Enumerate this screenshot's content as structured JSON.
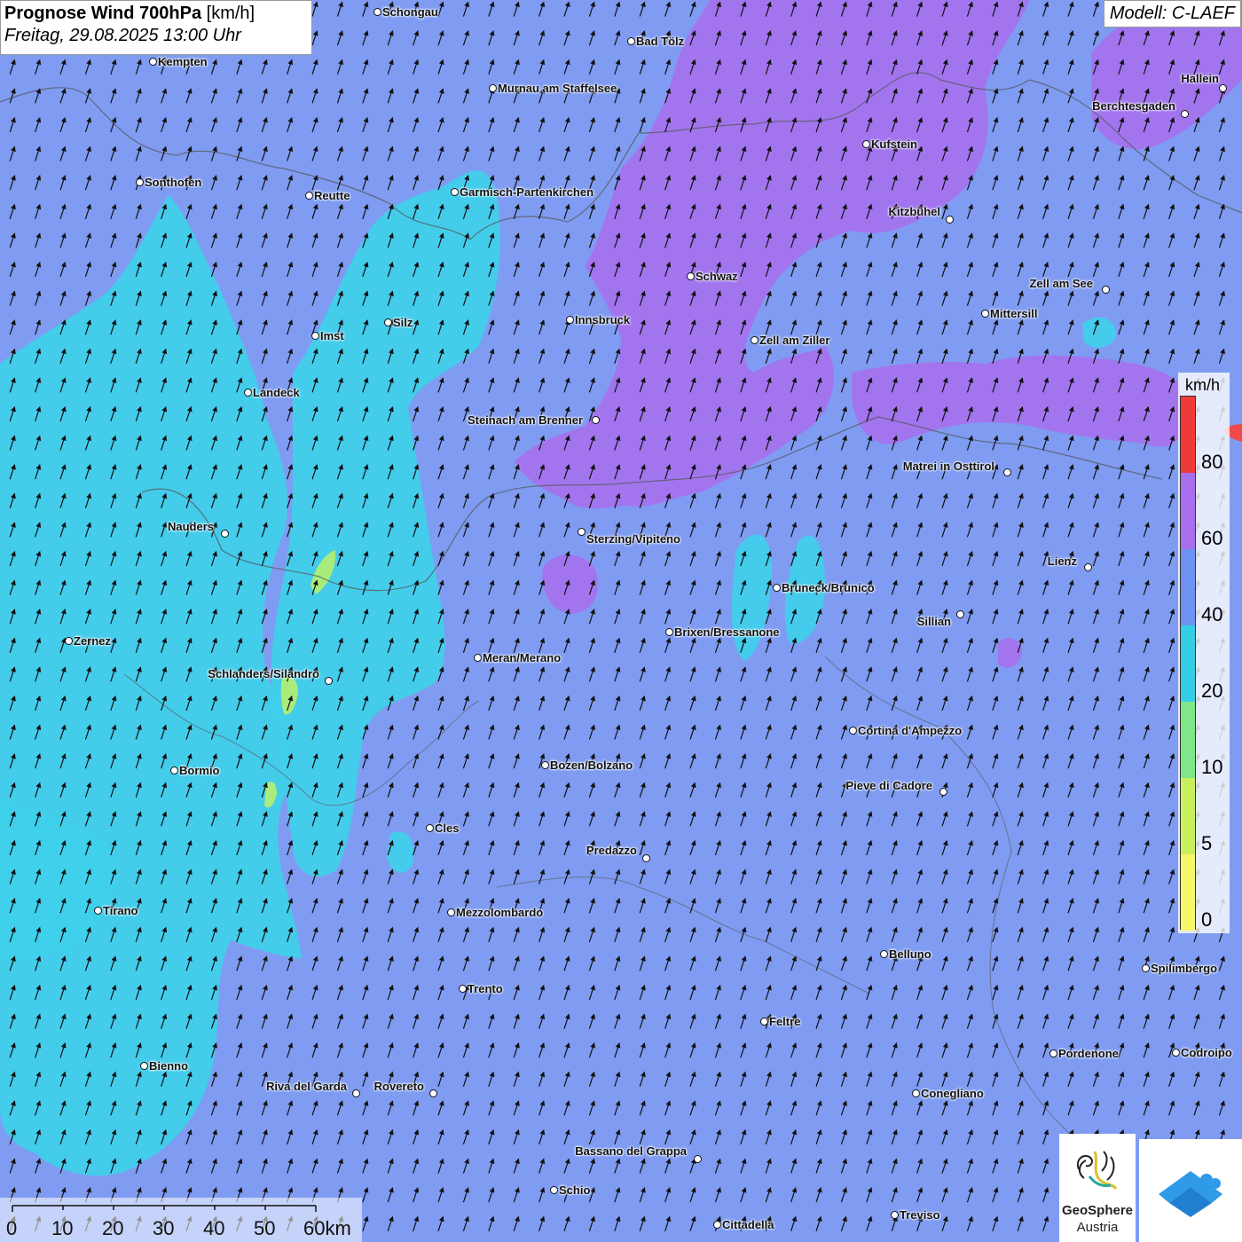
{
  "title": {
    "main": "Prognose Wind 700hPa",
    "unit": "[km/h]",
    "subtitle": "Freitag, 29.08.2025 13:00 Uhr"
  },
  "model": "Modell: C-LAEF",
  "legend": {
    "unit": "km/h",
    "ticks": [
      "0",
      "5",
      "10",
      "20",
      "40",
      "60",
      "80"
    ],
    "colors": [
      "#f7f76a",
      "#c9f05c",
      "#7fe68a",
      "#33cde6",
      "#6f93f2",
      "#a76ff0",
      "#f03a3a"
    ]
  },
  "scale_bar": {
    "labels": [
      "0",
      "10",
      "20",
      "30",
      "40",
      "50",
      "60km"
    ]
  },
  "logos": {
    "geosphere_name": "GeoSphere",
    "geosphere_sub": "Austria",
    "geosphere_icon": "geosphere-logo-icon",
    "second_icon": "app-logo-icon"
  },
  "wind_direction": "south-southwest (arrows pointing north-northeast)",
  "cities": [
    {
      "name": "Schongau"
    },
    {
      "name": "Bad Tölz"
    },
    {
      "name": "Kempten"
    },
    {
      "name": "Murnau am Staffelsee"
    },
    {
      "name": "Hallein"
    },
    {
      "name": "Berchtesgaden"
    },
    {
      "name": "Kufstein"
    },
    {
      "name": "Sonthofen"
    },
    {
      "name": "Reutte"
    },
    {
      "name": "Garmisch-Partenkirchen"
    },
    {
      "name": "Kitzbühel"
    },
    {
      "name": "Schwaz"
    },
    {
      "name": "Zell am See"
    },
    {
      "name": "Mittersill"
    },
    {
      "name": "Innsbruck"
    },
    {
      "name": "Imst"
    },
    {
      "name": "Silz"
    },
    {
      "name": "Zell am Ziller"
    },
    {
      "name": "Landeck"
    },
    {
      "name": "Steinach am Brenner"
    },
    {
      "name": "Matrei in Osttirol"
    },
    {
      "name": "Nauders"
    },
    {
      "name": "Sterzing/Vipiteno"
    },
    {
      "name": "Lienz"
    },
    {
      "name": "Bruneck/Brunico"
    },
    {
      "name": "Sillian"
    },
    {
      "name": "Zernez"
    },
    {
      "name": "Brixen/Bressanone"
    },
    {
      "name": "Meran/Merano"
    },
    {
      "name": "Schlanders/Silandro"
    },
    {
      "name": "Cortina d'Ampezzo"
    },
    {
      "name": "Bozen/Bolzano"
    },
    {
      "name": "Bormio"
    },
    {
      "name": "Pieve di Cadore"
    },
    {
      "name": "Cles"
    },
    {
      "name": "Predazzo"
    },
    {
      "name": "Tirano"
    },
    {
      "name": "Mezzolombardo"
    },
    {
      "name": "Belluno"
    },
    {
      "name": "Spilimbergo"
    },
    {
      "name": "Trento"
    },
    {
      "name": "Feltre"
    },
    {
      "name": "Pordenone"
    },
    {
      "name": "Codroipo"
    },
    {
      "name": "Bienno"
    },
    {
      "name": "Riva del Garda"
    },
    {
      "name": "Rovereto"
    },
    {
      "name": "Conegliano"
    },
    {
      "name": "Bassano del Grappa"
    },
    {
      "name": "Schio"
    },
    {
      "name": "Treviso"
    },
    {
      "name": "Cittadella"
    }
  ]
}
